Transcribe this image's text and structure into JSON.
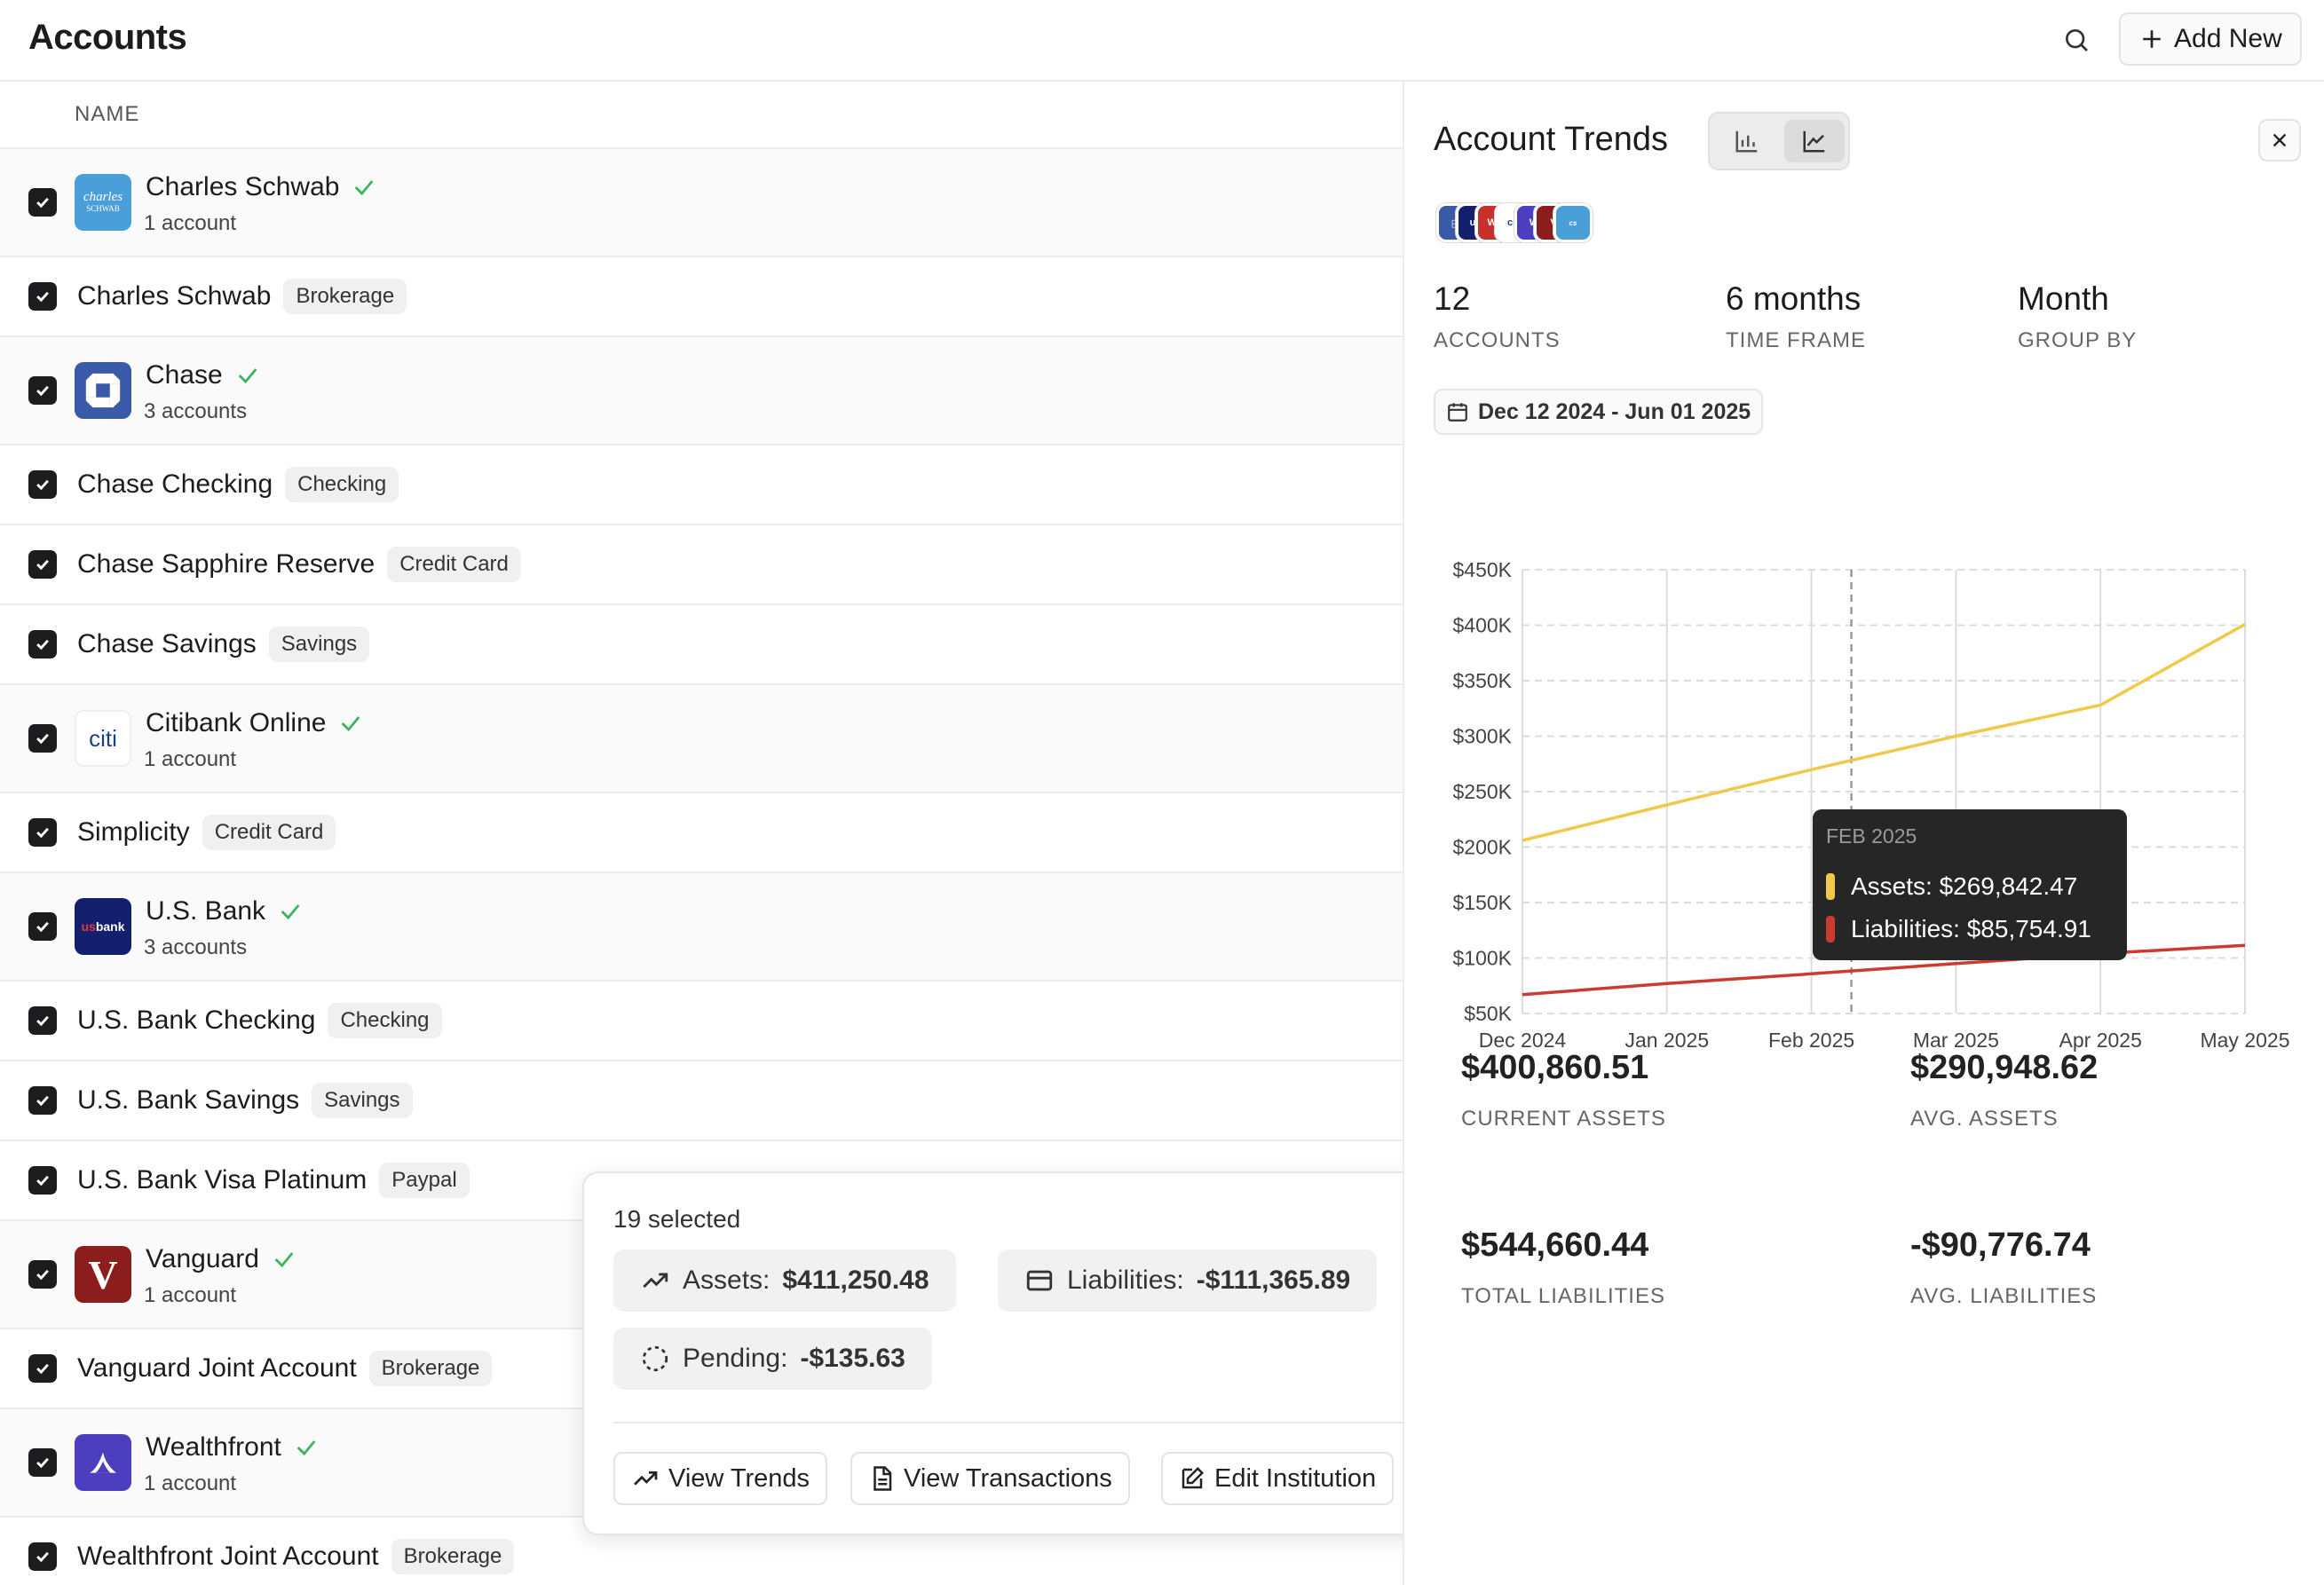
{
  "header": {
    "title": "Accounts",
    "add_label": "Add New"
  },
  "list": {
    "column_name": "NAME",
    "rows": [
      {
        "kind": "institution",
        "name": "Charles Schwab",
        "count": "1 account",
        "logo": "schwab"
      },
      {
        "kind": "account",
        "name": "Charles Schwab",
        "badge": "Brokerage"
      },
      {
        "kind": "institution",
        "name": "Chase",
        "count": "3 accounts",
        "logo": "chase"
      },
      {
        "kind": "account",
        "name": "Chase Checking",
        "badge": "Checking"
      },
      {
        "kind": "account",
        "name": "Chase Sapphire Reserve",
        "badge": "Credit Card"
      },
      {
        "kind": "account",
        "name": "Chase Savings",
        "badge": "Savings"
      },
      {
        "kind": "institution",
        "name": "Citibank Online",
        "count": "1 account",
        "logo": "citi"
      },
      {
        "kind": "account",
        "name": "Simplicity",
        "badge": "Credit Card"
      },
      {
        "kind": "institution",
        "name": "U.S. Bank",
        "count": "3 accounts",
        "logo": "usbank"
      },
      {
        "kind": "account",
        "name": "U.S. Bank Checking",
        "badge": "Checking"
      },
      {
        "kind": "account",
        "name": "U.S. Bank Savings",
        "badge": "Savings"
      },
      {
        "kind": "account",
        "name": "U.S. Bank Visa Platinum",
        "badge": "Paypal"
      },
      {
        "kind": "institution",
        "name": "Vanguard",
        "count": "1 account",
        "logo": "vanguard"
      },
      {
        "kind": "account",
        "name": "Vanguard Joint Account",
        "badge": "Brokerage"
      },
      {
        "kind": "institution",
        "name": "Wealthfront",
        "count": "1 account",
        "logo": "wealthfront"
      },
      {
        "kind": "account",
        "name": "Wealthfront Joint Account",
        "badge": "Brokerage"
      }
    ]
  },
  "logos": {
    "schwab": {
      "text": "charles SCHWAB",
      "bg": "#4a9fd8"
    },
    "chase": {
      "text": "",
      "bg": "#3a5aa8"
    },
    "citi": {
      "text": "citi",
      "bg": "#ffffff"
    },
    "usbank": {
      "text": "usbank",
      "bg": "#14206e"
    },
    "vanguard": {
      "text": "V",
      "bg": "#8c1d1d"
    },
    "wealthfront": {
      "text": "",
      "bg": "#4b3fbf"
    }
  },
  "selection": {
    "count": "19 selected",
    "assets_label": "Assets:",
    "assets_value": "$411,250.48",
    "liabilities_label": "Liabilities:",
    "liabilities_value": "-$111,365.89",
    "pending_label": "Pending:",
    "pending_value": "-$135.63",
    "actions": {
      "view_trends": "View Trends",
      "view_transactions": "View Transactions",
      "edit_institution": "Edit Institution"
    }
  },
  "trends": {
    "title": "Account Trends",
    "stats": [
      {
        "value": "12",
        "label": "ACCOUNTS"
      },
      {
        "value": "6 months",
        "label": "TIME FRAME"
      },
      {
        "value": "Month",
        "label": "GROUP BY"
      }
    ],
    "date_range": "Dec 12 2024 - Jun 01 2025",
    "tooltip": {
      "title": "FEB 2025",
      "assets": "Assets: $269,842.47",
      "liabilities": "Liabilities: $85,754.91"
    },
    "summary": [
      {
        "value": "$400,860.51",
        "label": "CURRENT ASSETS"
      },
      {
        "value": "$290,948.62",
        "label": "AVG. ASSETS"
      },
      {
        "value": "$544,660.44",
        "label": "TOTAL LIABILITIES"
      },
      {
        "value": "-$90,776.74",
        "label": "AVG. LIABILITIES"
      }
    ]
  },
  "colors": {
    "assets": "#f0c94a",
    "liabilities": "#cc3b2f",
    "check_green": "#3bb55d"
  },
  "chart_data": {
    "type": "line",
    "categories": [
      "Dec 2024",
      "Jan 2025",
      "Feb 2025",
      "Mar 2025",
      "Apr 2025",
      "May 2025"
    ],
    "y_ticks": [
      "$50K",
      "$100K",
      "$150K",
      "$200K",
      "$250K",
      "$300K",
      "$350K",
      "$400K",
      "$450K"
    ],
    "ylim": [
      50000,
      450000
    ],
    "grid": true,
    "series": [
      {
        "name": "Assets",
        "color": "#f0c94a",
        "values": [
          206000,
          238000,
          269842,
          300000,
          328000,
          400860
        ]
      },
      {
        "name": "Liabilities",
        "color": "#cc3b2f",
        "values": [
          67000,
          77000,
          85755,
          95000,
          104000,
          111366
        ]
      }
    ],
    "highlight_index": 2
  }
}
